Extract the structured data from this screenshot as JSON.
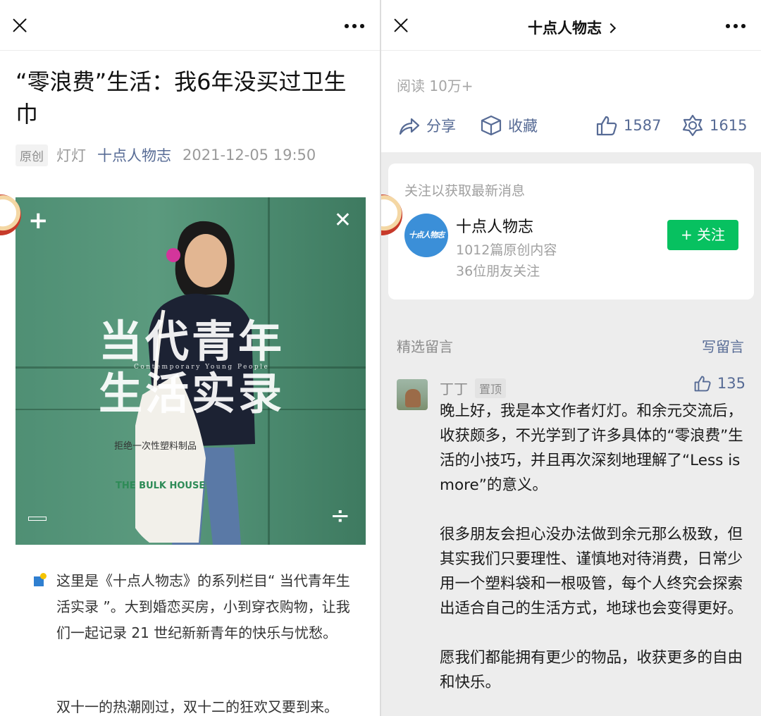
{
  "left": {
    "title": "“零浪费”生活：我6年没买过卫生巾",
    "meta": {
      "badge": "原创",
      "author": "灯灯",
      "account": "十点人物志",
      "datetime": "2021-12-05 19:50"
    },
    "hero": {
      "headline_line1": "当代青年",
      "headline_line2": "生活实录",
      "subtitle": "Contemporary Young People",
      "bag_text_1": "拒绝一次性塑料制品",
      "bag_text_2": "THE BULK HOUSE"
    },
    "intro": "这里是《十点人物志》的系列栏目“ 当代青年生活实录 ”。大到婚恋买房，小到穿衣购物，让我们一起记录 21 世纪新新青年的快乐与忧愁。",
    "para2": "双十一的热潮刚过，双十二的狂欢又要到来。"
  },
  "right": {
    "header_title": "十点人物志",
    "reads": "阅读 10万+",
    "actions": {
      "share": "分享",
      "collect": "收藏",
      "likes": "1587",
      "wow": "1615"
    },
    "card": {
      "hint": "关注以获取最新消息",
      "avatar_text": "十点人物志",
      "name": "十点人物志",
      "articles": "1012篇原创内容",
      "friends": "36位朋友关注",
      "follow": "+ 关注"
    },
    "comments": {
      "header": "精选留言",
      "write": "写留言",
      "item": {
        "name": "丁丁",
        "pin": "置顶",
        "likes": "135",
        "p1": "晚上好，我是本文作者灯灯。和余元交流后，收获颇多，不光学到了许多具体的“零浪费”生活的小技巧，并且再次深刻地理解了“Less is more”的意义。",
        "p2": "很多朋友会担心没办法做到余元那么极致，但其实我们只要理性、谨慎地对待消费，日常少用一个塑料袋和一根吸管，每个人终究会探索出适合自己的生活方式，地球也会变得更好。",
        "p3": "愿我们都能拥有更少的物品，收获更多的自由和快乐。"
      }
    }
  },
  "colors": {
    "link": "#576b95",
    "follow_green": "#07c160",
    "muted": "#8c8c8c",
    "hero_green": "#5b9a7e"
  }
}
